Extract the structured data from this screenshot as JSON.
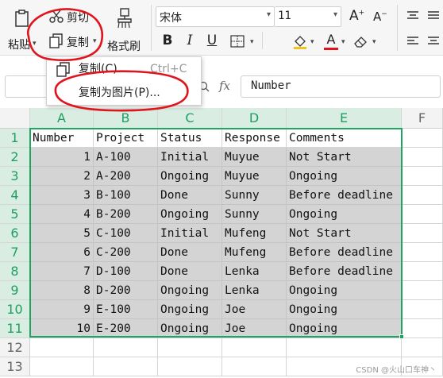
{
  "ribbon": {
    "cut_label": "剪切",
    "paste_label": "粘贴",
    "copy_label": "复制",
    "format_painter_label": "格式刷",
    "font_name": "宋体",
    "font_size": "11"
  },
  "copy_menu": {
    "items": [
      {
        "label": "复制(C)",
        "shortcut": "Ctrl+C"
      },
      {
        "label": "复制为图片(P)..."
      }
    ]
  },
  "formula_bar": {
    "fx_label": "fx",
    "value": "Number"
  },
  "sheet": {
    "columns": [
      "A",
      "B",
      "C",
      "D",
      "E",
      "F"
    ],
    "rows": [
      "1",
      "2",
      "3",
      "4",
      "5",
      "6",
      "7",
      "8",
      "9",
      "10",
      "11",
      "12",
      "13"
    ],
    "header": [
      "Number",
      "Project",
      "Status",
      "Response",
      "Comments"
    ],
    "data": [
      [
        "1",
        "A-100",
        "Initial",
        "Muyue",
        "Not Start"
      ],
      [
        "2",
        "A-200",
        "Ongoing",
        "Muyue",
        "Ongoing"
      ],
      [
        "3",
        "B-100",
        "Done",
        "Sunny",
        "Before deadline"
      ],
      [
        "4",
        "B-200",
        "Ongoing",
        "Sunny",
        "Ongoing"
      ],
      [
        "5",
        "C-100",
        "Initial",
        "Mufeng",
        "Not Start"
      ],
      [
        "6",
        "C-200",
        "Done",
        "Mufeng",
        "Before deadline"
      ],
      [
        "7",
        "D-100",
        "Done",
        "Lenka",
        "Before deadline"
      ],
      [
        "8",
        "D-200",
        "Ongoing",
        "Lenka",
        "Ongoing"
      ],
      [
        "9",
        "E-100",
        "Ongoing",
        "Joe",
        "Ongoing"
      ],
      [
        "10",
        "E-200",
        "Ongoing",
        "Joe",
        "Ongoing"
      ]
    ]
  },
  "watermark": "CSDN @火山口车神丶",
  "colors": {
    "selection": "#1fa463",
    "annotation": "#e0141c",
    "shade": "#d4d4d4"
  }
}
